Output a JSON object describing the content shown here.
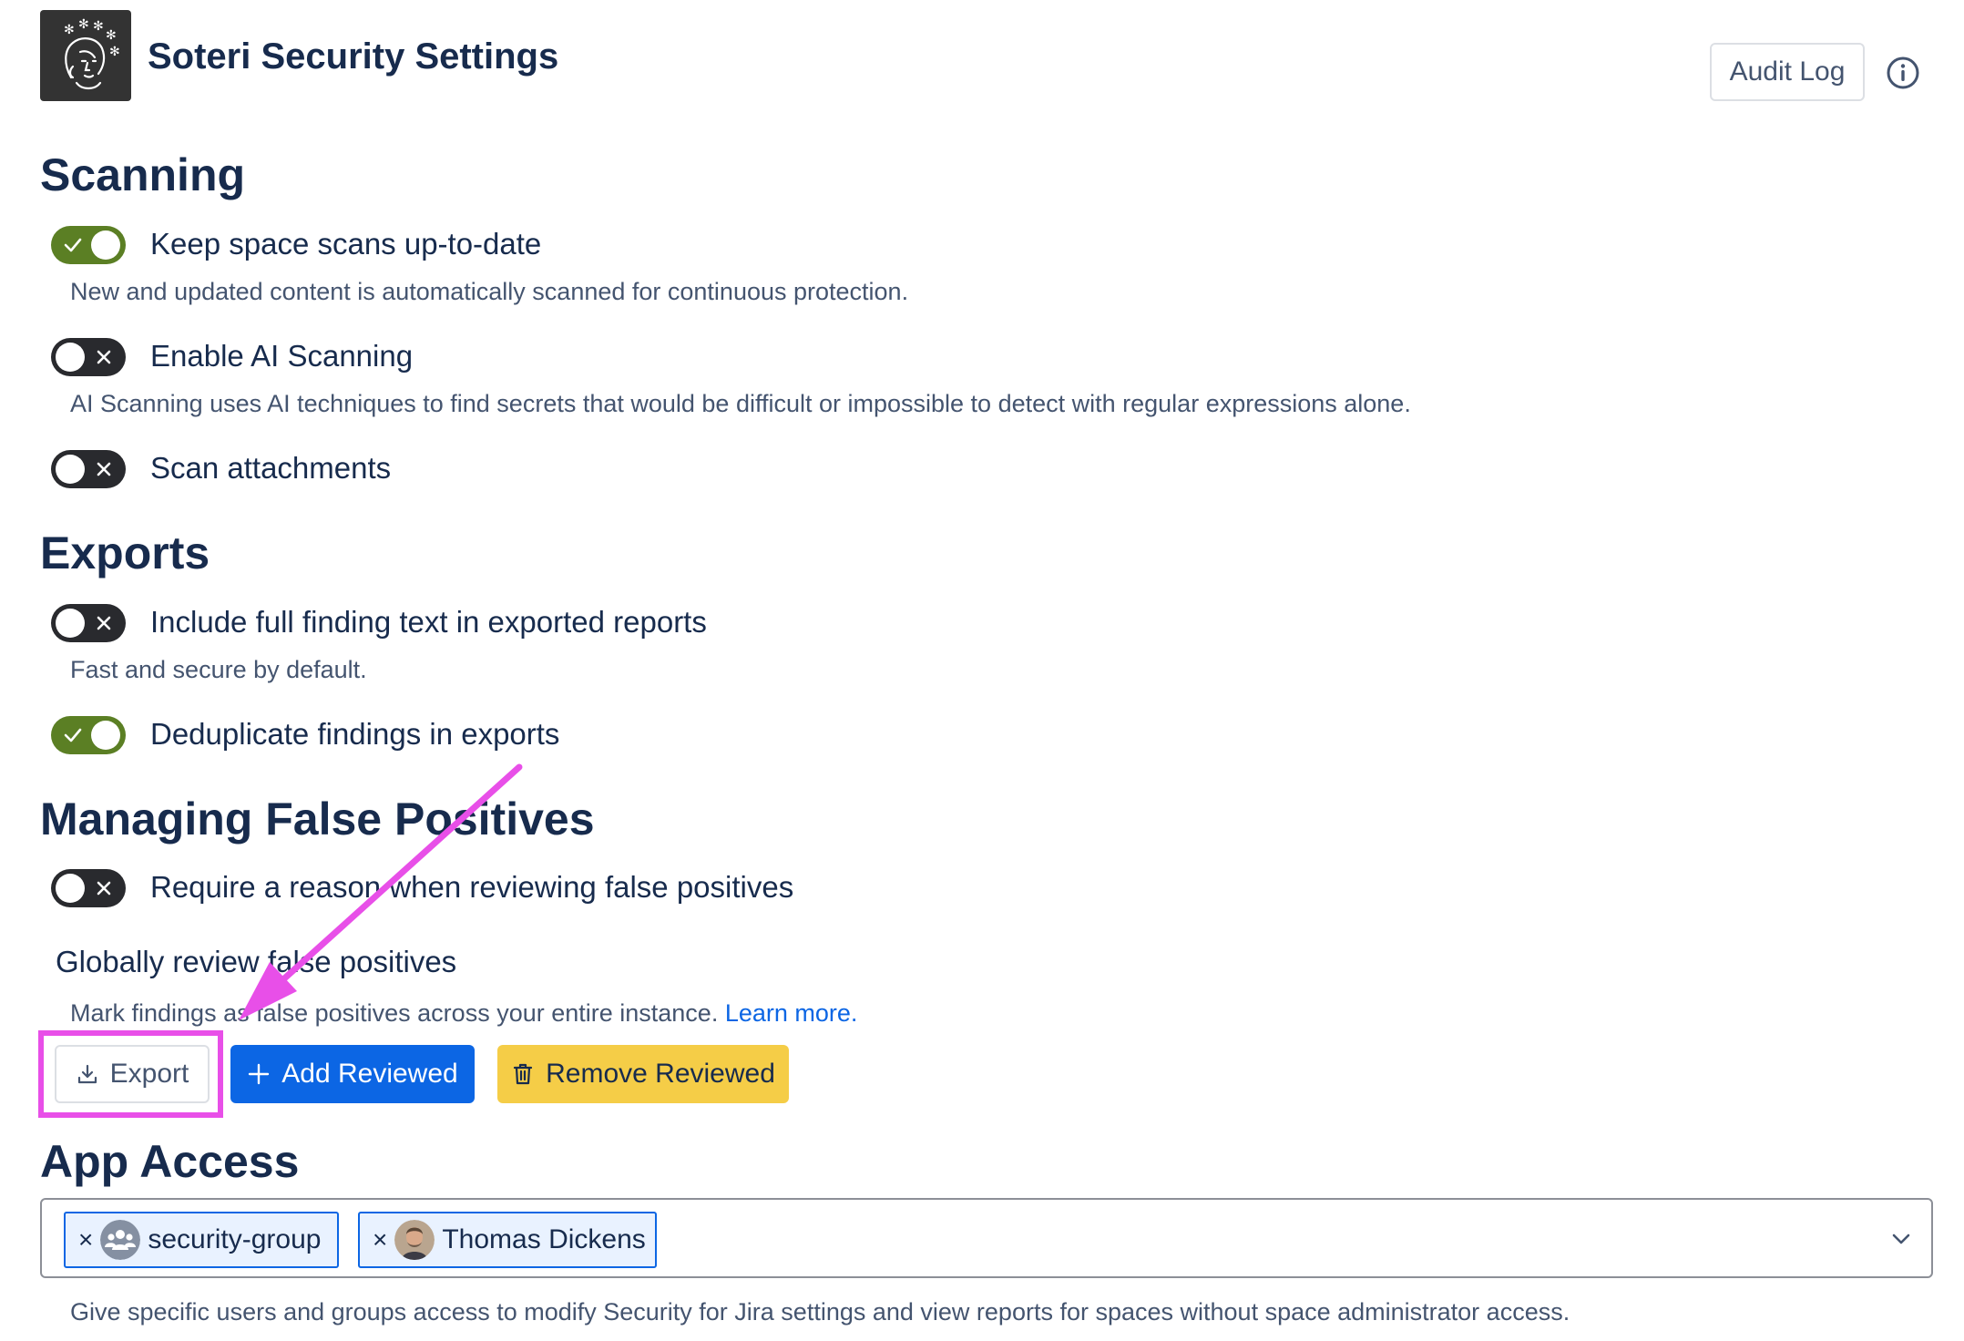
{
  "header": {
    "title": "Soteri Security Settings",
    "audit_log_label": "Audit Log",
    "logo_icon": "soteri-logo-icon",
    "info_icon": "info-icon"
  },
  "scanning": {
    "title": "Scanning",
    "settings": [
      {
        "label": "Keep space scans up-to-date",
        "enabled": true,
        "description": "New and updated content is automatically scanned for continuous protection."
      },
      {
        "label": "Enable AI Scanning",
        "enabled": false,
        "description": "AI Scanning uses AI techniques to find secrets that would be difficult or impossible to detect with regular expressions alone."
      },
      {
        "label": "Scan attachments",
        "enabled": false
      }
    ]
  },
  "exports": {
    "title": "Exports",
    "settings": [
      {
        "label": "Include full finding text in exported reports",
        "enabled": false,
        "description": "Fast and secure by default."
      },
      {
        "label": "Deduplicate findings in exports",
        "enabled": true
      }
    ]
  },
  "false_positives": {
    "title": "Managing False Positives",
    "require_reason": {
      "label": "Require a reason when reviewing false positives",
      "enabled": false
    },
    "global_review": {
      "label": "Globally review false positives",
      "description": "Mark findings as false positives across your entire instance.",
      "learn_more": "Learn more."
    },
    "buttons": {
      "export": "Export",
      "add_reviewed": "Add Reviewed",
      "remove_reviewed": "Remove Reviewed"
    }
  },
  "app_access": {
    "title": "App Access",
    "selected": [
      {
        "label": "security-group",
        "type": "group",
        "remove": "×"
      },
      {
        "label": "Thomas Dickens",
        "type": "user",
        "remove": "×"
      }
    ],
    "description": "Give specific users and groups access to modify Security for Jira settings and view reports for spaces without space administrator access."
  },
  "colors": {
    "toggle_on": "#5b7f24",
    "toggle_off": "#292a2e",
    "primary": "#0c66e4",
    "warning": "#f5cd47",
    "annotation": "#e84fe8"
  }
}
